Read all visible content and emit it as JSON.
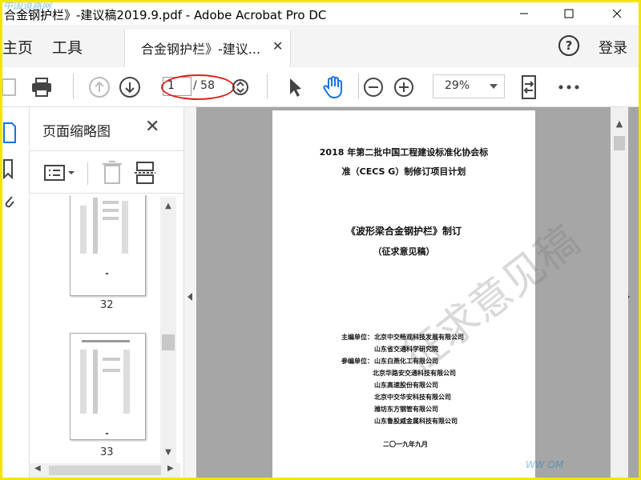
{
  "window": {
    "title": "合金钢护栏》-建议稿2019.9.pdf - Adobe Acrobat Pro DC"
  },
  "menubar": {
    "home": "主页",
    "tools": "工具",
    "doc_tab": "合金钢护栏》-建议...",
    "login": "登录",
    "help": "?"
  },
  "toolbar": {
    "page_current": "1",
    "page_total": "/ 58",
    "zoom": "29%"
  },
  "thumbnails": {
    "panel_title": "页面缩略图",
    "pages": [
      {
        "number": "32"
      },
      {
        "number": "33"
      }
    ]
  },
  "document": {
    "title_line1": "2018 年第二批中国工程建设标准化协会标",
    "title_line2": "准（CECS G）制修订项目计划",
    "subtitle1": "《波形梁合金钢护栏》制订",
    "subtitle2": "（征求意见稿）",
    "watermark": "征求意见稿",
    "chief_label": "主编单位：",
    "chief_orgs": [
      "北京中交畅观科技发展有限公司",
      "山东省交通科学研究院"
    ],
    "participant_label": "参编单位：",
    "participant_orgs": [
      "山东白燕化工有限公司",
      "北京华路安交通科技有限公司",
      "山东高速股份有限公司",
      "北京中交华安科技有限公司",
      "潍坊东方钢管有限公司",
      "山东鲁股威金属科技有限公司"
    ],
    "date": "二〇一九年九月"
  },
  "corner_watermarks": {
    "top_left": "中国道路网",
    "bottom_right": "WW         OM"
  },
  "colors": {
    "highlight_oval": "#e0201c",
    "hand_tool": "#1473e6",
    "frame": "#f2e600"
  }
}
